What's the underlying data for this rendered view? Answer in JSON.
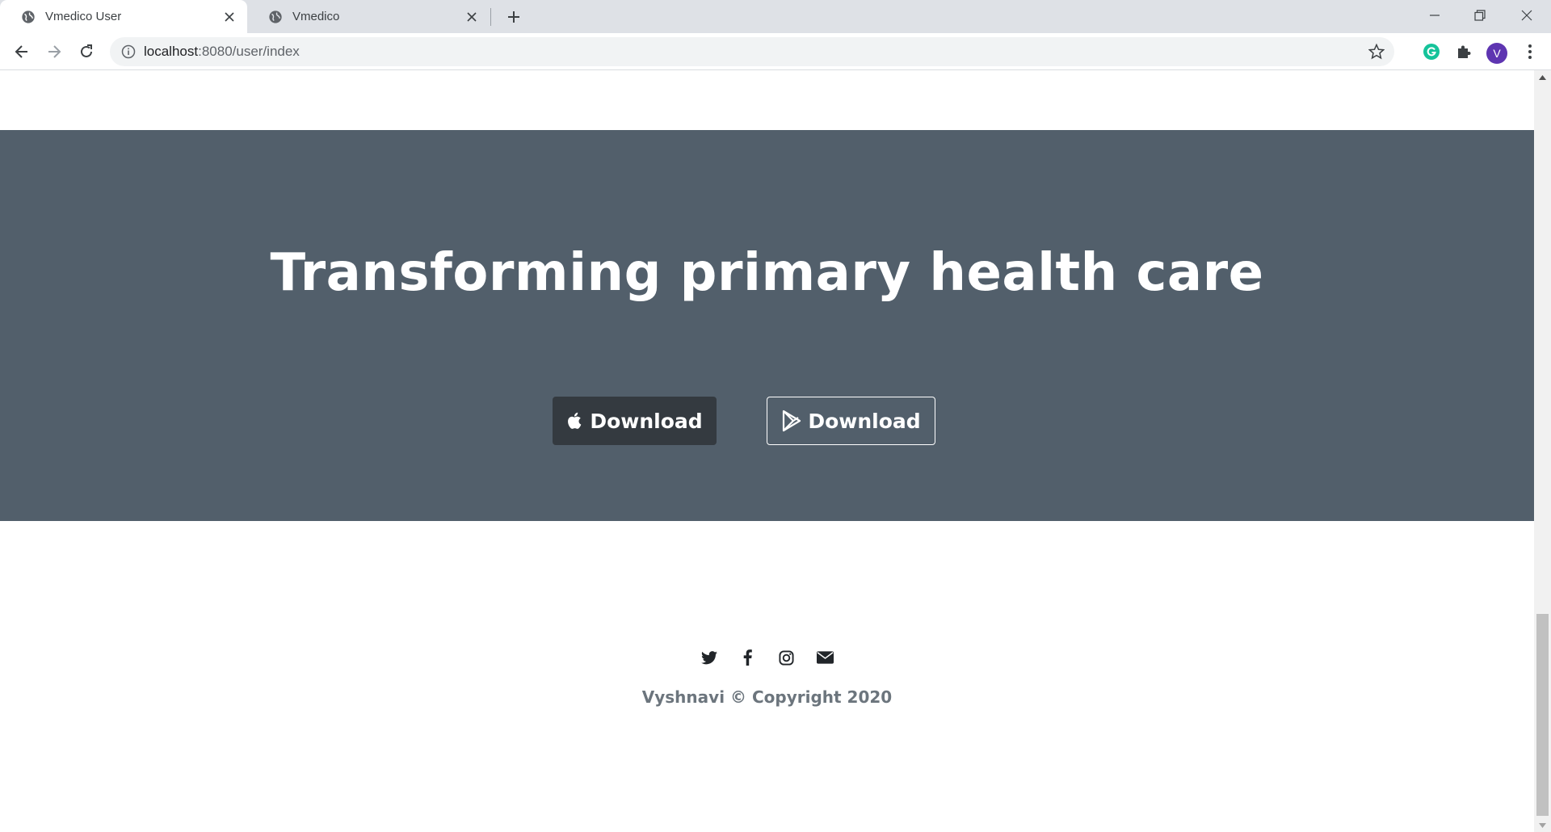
{
  "browser": {
    "tabs": [
      {
        "title": "Vmedico User",
        "active": true
      },
      {
        "title": "Vmedico",
        "active": false
      }
    ],
    "address": {
      "host": "localhost",
      "rest": ":8080/user/index"
    },
    "profile_initial": "V"
  },
  "hero": {
    "title": "Transforming primary health care",
    "apple_button_label": "Download",
    "play_button_label": "Download",
    "background_color": "#525f6b"
  },
  "footer": {
    "social_icons": [
      "twitter-icon",
      "facebook-icon",
      "instagram-icon",
      "envelope-icon"
    ],
    "copyright": "Vyshnavi © Copyright 2020"
  }
}
